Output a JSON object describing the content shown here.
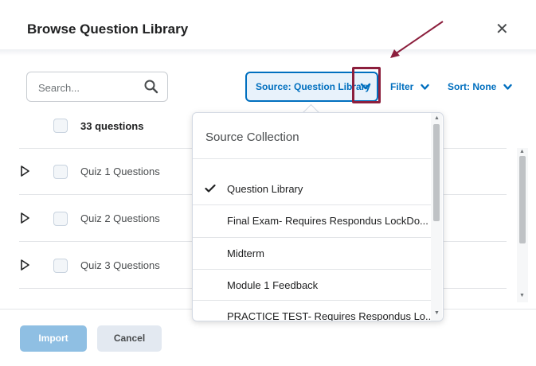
{
  "dialog": {
    "title": "Browse Question Library",
    "close_icon": "close-icon"
  },
  "toolbar": {
    "search_placeholder": "Search...",
    "source_label": "Source: Question Library",
    "filter_label": "Filter",
    "sort_label": "Sort: None"
  },
  "list": {
    "count_label": "33 questions",
    "rows": [
      {
        "label": "Quiz 1 Questions"
      },
      {
        "label": "Quiz 2 Questions"
      },
      {
        "label": "Quiz 3 Questions"
      }
    ]
  },
  "dropdown": {
    "header": "Source Collection",
    "items": [
      {
        "label": "Question Library",
        "selected": true
      },
      {
        "label": "Final Exam- Requires Respondus LockDo...",
        "selected": false
      },
      {
        "label": "Midterm",
        "selected": false
      },
      {
        "label": "Module 1 Feedback",
        "selected": false
      },
      {
        "label": "PRACTICE TEST- Requires Respondus Lo...",
        "selected": false
      }
    ]
  },
  "footer": {
    "import_label": "Import",
    "cancel_label": "Cancel"
  },
  "colors": {
    "accent": "#006fbf",
    "annotation": "#8c1f3d",
    "import_disabled": "#8fbfe3"
  }
}
